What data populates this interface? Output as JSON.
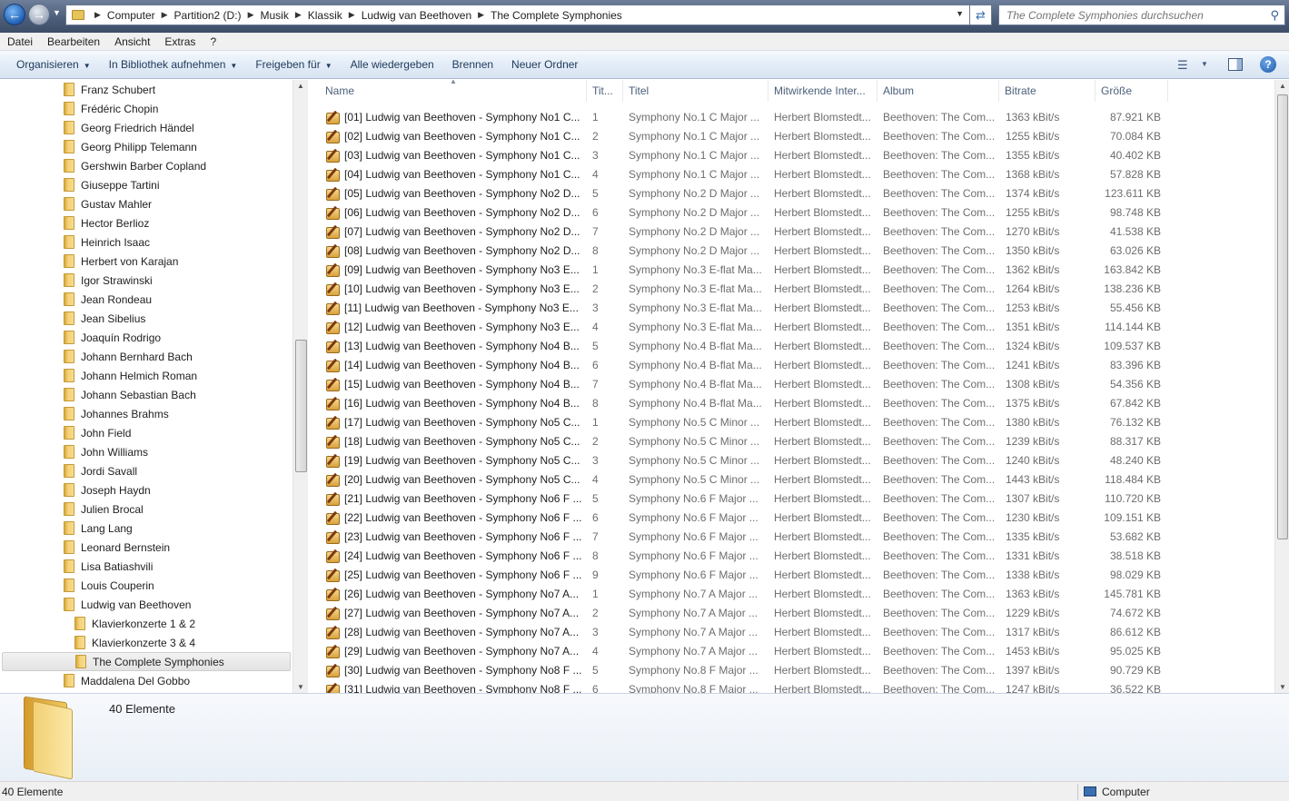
{
  "address": {
    "crumbs": [
      "Computer",
      "Partition2 (D:)",
      "Musik",
      "Klassik",
      "Ludwig van Beethoven",
      "The Complete Symphonies"
    ],
    "search_placeholder": "The Complete Symphonies durchsuchen"
  },
  "menu": [
    "Datei",
    "Bearbeiten",
    "Ansicht",
    "Extras",
    "?"
  ],
  "commands": [
    {
      "label": "Organisieren",
      "dropdown": true
    },
    {
      "label": "In Bibliothek aufnehmen",
      "dropdown": true
    },
    {
      "label": "Freigeben für",
      "dropdown": true
    },
    {
      "label": "Alle wiedergeben",
      "dropdown": false
    },
    {
      "label": "Brennen",
      "dropdown": false
    },
    {
      "label": "Neuer Ordner",
      "dropdown": false
    }
  ],
  "tree": [
    {
      "label": "Franz Schubert",
      "level": 1
    },
    {
      "label": "Frédéric Chopin",
      "level": 1
    },
    {
      "label": "Georg Friedrich Händel",
      "level": 1
    },
    {
      "label": "Georg Philipp Telemann",
      "level": 1
    },
    {
      "label": "Gershwin Barber Copland",
      "level": 1
    },
    {
      "label": "Giuseppe Tartini",
      "level": 1
    },
    {
      "label": "Gustav Mahler",
      "level": 1
    },
    {
      "label": "Hector Berlioz",
      "level": 1
    },
    {
      "label": "Heinrich Isaac",
      "level": 1
    },
    {
      "label": "Herbert von Karajan",
      "level": 1
    },
    {
      "label": "Igor Strawinski",
      "level": 1
    },
    {
      "label": "Jean Rondeau",
      "level": 1
    },
    {
      "label": "Jean Sibelius",
      "level": 1
    },
    {
      "label": "Joaquín Rodrigo",
      "level": 1
    },
    {
      "label": "Johann Bernhard Bach",
      "level": 1
    },
    {
      "label": "Johann Helmich Roman",
      "level": 1
    },
    {
      "label": "Johann Sebastian Bach",
      "level": 1
    },
    {
      "label": "Johannes Brahms",
      "level": 1
    },
    {
      "label": "John Field",
      "level": 1
    },
    {
      "label": "John Williams",
      "level": 1
    },
    {
      "label": "Jordi Savall",
      "level": 1
    },
    {
      "label": "Joseph Haydn",
      "level": 1
    },
    {
      "label": "Julien Brocal",
      "level": 1
    },
    {
      "label": "Lang Lang",
      "level": 1
    },
    {
      "label": "Leonard Bernstein",
      "level": 1
    },
    {
      "label": "Lisa Batiashvili",
      "level": 1
    },
    {
      "label": "Louis Couperin",
      "level": 1
    },
    {
      "label": "Ludwig van Beethoven",
      "level": 1
    },
    {
      "label": "Klavierkonzerte 1 & 2",
      "level": 2
    },
    {
      "label": "Klavierkonzerte 3 & 4",
      "level": 2
    },
    {
      "label": "The Complete Symphonies",
      "level": 2,
      "selected": true
    },
    {
      "label": "Maddalena Del Gobbo",
      "level": 1
    }
  ],
  "columns": [
    "Name",
    "Tit...",
    "Titel",
    "Mitwirkende Inter...",
    "Album",
    "Bitrate",
    "Größe"
  ],
  "files": [
    {
      "name": "[01] Ludwig van Beethoven - Symphony No1 C...",
      "track": "1",
      "title": "Symphony No.1 C Major ...",
      "artist": "Herbert Blomstedt...",
      "album": "Beethoven: The Com...",
      "bitrate": "1363 kBit/s",
      "size": "87.921 KB"
    },
    {
      "name": "[02] Ludwig van Beethoven - Symphony No1 C...",
      "track": "2",
      "title": "Symphony No.1 C Major ...",
      "artist": "Herbert Blomstedt...",
      "album": "Beethoven: The Com...",
      "bitrate": "1255 kBit/s",
      "size": "70.084 KB"
    },
    {
      "name": "[03] Ludwig van Beethoven - Symphony No1 C...",
      "track": "3",
      "title": "Symphony No.1 C Major ...",
      "artist": "Herbert Blomstedt...",
      "album": "Beethoven: The Com...",
      "bitrate": "1355 kBit/s",
      "size": "40.402 KB"
    },
    {
      "name": "[04] Ludwig van Beethoven - Symphony No1 C...",
      "track": "4",
      "title": "Symphony No.1 C Major ...",
      "artist": "Herbert Blomstedt...",
      "album": "Beethoven: The Com...",
      "bitrate": "1368 kBit/s",
      "size": "57.828 KB"
    },
    {
      "name": "[05] Ludwig van Beethoven - Symphony No2 D...",
      "track": "5",
      "title": "Symphony No.2 D Major ...",
      "artist": "Herbert Blomstedt...",
      "album": "Beethoven: The Com...",
      "bitrate": "1374 kBit/s",
      "size": "123.611 KB"
    },
    {
      "name": "[06] Ludwig van Beethoven - Symphony No2 D...",
      "track": "6",
      "title": "Symphony No.2 D Major ...",
      "artist": "Herbert Blomstedt...",
      "album": "Beethoven: The Com...",
      "bitrate": "1255 kBit/s",
      "size": "98.748 KB"
    },
    {
      "name": "[07] Ludwig van Beethoven - Symphony No2 D...",
      "track": "7",
      "title": "Symphony No.2 D Major ...",
      "artist": "Herbert Blomstedt...",
      "album": "Beethoven: The Com...",
      "bitrate": "1270 kBit/s",
      "size": "41.538 KB"
    },
    {
      "name": "[08] Ludwig van Beethoven - Symphony No2 D...",
      "track": "8",
      "title": "Symphony No.2 D Major ...",
      "artist": "Herbert Blomstedt...",
      "album": "Beethoven: The Com...",
      "bitrate": "1350 kBit/s",
      "size": "63.026 KB"
    },
    {
      "name": "[09] Ludwig van Beethoven - Symphony No3 E...",
      "track": "1",
      "title": "Symphony No.3 E-flat Ma...",
      "artist": "Herbert Blomstedt...",
      "album": "Beethoven: The Com...",
      "bitrate": "1362 kBit/s",
      "size": "163.842 KB"
    },
    {
      "name": "[10] Ludwig van Beethoven - Symphony No3 E...",
      "track": "2",
      "title": "Symphony No.3 E-flat Ma...",
      "artist": "Herbert Blomstedt...",
      "album": "Beethoven: The Com...",
      "bitrate": "1264 kBit/s",
      "size": "138.236 KB"
    },
    {
      "name": "[11] Ludwig van Beethoven - Symphony No3 E...",
      "track": "3",
      "title": "Symphony No.3 E-flat Ma...",
      "artist": "Herbert Blomstedt...",
      "album": "Beethoven: The Com...",
      "bitrate": "1253 kBit/s",
      "size": "55.456 KB"
    },
    {
      "name": "[12] Ludwig van Beethoven - Symphony No3 E...",
      "track": "4",
      "title": "Symphony No.3 E-flat Ma...",
      "artist": "Herbert Blomstedt...",
      "album": "Beethoven: The Com...",
      "bitrate": "1351 kBit/s",
      "size": "114.144 KB"
    },
    {
      "name": "[13] Ludwig van Beethoven - Symphony No4 B...",
      "track": "5",
      "title": "Symphony No.4 B-flat Ma...",
      "artist": "Herbert Blomstedt...",
      "album": "Beethoven: The Com...",
      "bitrate": "1324 kBit/s",
      "size": "109.537 KB"
    },
    {
      "name": "[14] Ludwig van Beethoven - Symphony No4 B...",
      "track": "6",
      "title": "Symphony No.4 B-flat Ma...",
      "artist": "Herbert Blomstedt...",
      "album": "Beethoven: The Com...",
      "bitrate": "1241 kBit/s",
      "size": "83.396 KB"
    },
    {
      "name": "[15] Ludwig van Beethoven - Symphony No4 B...",
      "track": "7",
      "title": "Symphony No.4 B-flat Ma...",
      "artist": "Herbert Blomstedt...",
      "album": "Beethoven: The Com...",
      "bitrate": "1308 kBit/s",
      "size": "54.356 KB"
    },
    {
      "name": "[16] Ludwig van Beethoven - Symphony No4 B...",
      "track": "8",
      "title": "Symphony No.4 B-flat Ma...",
      "artist": "Herbert Blomstedt...",
      "album": "Beethoven: The Com...",
      "bitrate": "1375 kBit/s",
      "size": "67.842 KB"
    },
    {
      "name": "[17] Ludwig van Beethoven - Symphony No5 C...",
      "track": "1",
      "title": "Symphony No.5 C Minor ...",
      "artist": "Herbert Blomstedt...",
      "album": "Beethoven: The Com...",
      "bitrate": "1380 kBit/s",
      "size": "76.132 KB"
    },
    {
      "name": "[18] Ludwig van Beethoven - Symphony No5 C...",
      "track": "2",
      "title": "Symphony No.5 C Minor ...",
      "artist": "Herbert Blomstedt...",
      "album": "Beethoven: The Com...",
      "bitrate": "1239 kBit/s",
      "size": "88.317 KB"
    },
    {
      "name": "[19] Ludwig van Beethoven - Symphony No5 C...",
      "track": "3",
      "title": "Symphony No.5 C Minor ...",
      "artist": "Herbert Blomstedt...",
      "album": "Beethoven: The Com...",
      "bitrate": "1240 kBit/s",
      "size": "48.240 KB"
    },
    {
      "name": "[20] Ludwig van Beethoven - Symphony No5 C...",
      "track": "4",
      "title": "Symphony No.5 C Minor ...",
      "artist": "Herbert Blomstedt...",
      "album": "Beethoven: The Com...",
      "bitrate": "1443 kBit/s",
      "size": "118.484 KB"
    },
    {
      "name": "[21] Ludwig van Beethoven - Symphony No6 F ...",
      "track": "5",
      "title": "Symphony No.6 F Major ...",
      "artist": "Herbert Blomstedt...",
      "album": "Beethoven: The Com...",
      "bitrate": "1307 kBit/s",
      "size": "110.720 KB"
    },
    {
      "name": "[22] Ludwig van Beethoven - Symphony No6 F ...",
      "track": "6",
      "title": "Symphony No.6 F Major ...",
      "artist": "Herbert Blomstedt...",
      "album": "Beethoven: The Com...",
      "bitrate": "1230 kBit/s",
      "size": "109.151 KB"
    },
    {
      "name": "[23] Ludwig van Beethoven - Symphony No6 F ...",
      "track": "7",
      "title": "Symphony No.6 F Major ...",
      "artist": "Herbert Blomstedt...",
      "album": "Beethoven: The Com...",
      "bitrate": "1335 kBit/s",
      "size": "53.682 KB"
    },
    {
      "name": "[24] Ludwig van Beethoven - Symphony No6 F ...",
      "track": "8",
      "title": "Symphony No.6 F Major ...",
      "artist": "Herbert Blomstedt...",
      "album": "Beethoven: The Com...",
      "bitrate": "1331 kBit/s",
      "size": "38.518 KB"
    },
    {
      "name": "[25] Ludwig van Beethoven - Symphony No6 F ...",
      "track": "9",
      "title": "Symphony No.6 F Major ...",
      "artist": "Herbert Blomstedt...",
      "album": "Beethoven: The Com...",
      "bitrate": "1338 kBit/s",
      "size": "98.029 KB"
    },
    {
      "name": "[26] Ludwig van Beethoven - Symphony No7 A...",
      "track": "1",
      "title": "Symphony No.7 A Major ...",
      "artist": "Herbert Blomstedt...",
      "album": "Beethoven: The Com...",
      "bitrate": "1363 kBit/s",
      "size": "145.781 KB"
    },
    {
      "name": "[27] Ludwig van Beethoven - Symphony No7 A...",
      "track": "2",
      "title": "Symphony No.7 A Major ...",
      "artist": "Herbert Blomstedt...",
      "album": "Beethoven: The Com...",
      "bitrate": "1229 kBit/s",
      "size": "74.672 KB"
    },
    {
      "name": "[28] Ludwig van Beethoven - Symphony No7 A...",
      "track": "3",
      "title": "Symphony No.7 A Major ...",
      "artist": "Herbert Blomstedt...",
      "album": "Beethoven: The Com...",
      "bitrate": "1317 kBit/s",
      "size": "86.612 KB"
    },
    {
      "name": "[29] Ludwig van Beethoven - Symphony No7 A...",
      "track": "4",
      "title": "Symphony No.7 A Major ...",
      "artist": "Herbert Blomstedt...",
      "album": "Beethoven: The Com...",
      "bitrate": "1453 kBit/s",
      "size": "95.025 KB"
    },
    {
      "name": "[30] Ludwig van Beethoven - Symphony No8 F ...",
      "track": "5",
      "title": "Symphony No.8 F Major ...",
      "artist": "Herbert Blomstedt...",
      "album": "Beethoven: The Com...",
      "bitrate": "1397 kBit/s",
      "size": "90.729 KB"
    },
    {
      "name": "[31] Ludwig van Beethoven - Symphony No8 F ...",
      "track": "6",
      "title": "Symphony No.8 F Major ...",
      "artist": "Herbert Blomstedt...",
      "album": "Beethoven: The Com...",
      "bitrate": "1247 kBit/s",
      "size": "36.522 KB"
    }
  ],
  "details": {
    "count": "40 Elemente"
  },
  "status": {
    "count": "40 Elemente",
    "location": "Computer"
  },
  "icons": {
    "back": "back-arrow-icon",
    "forward": "forward-arrow-icon",
    "search": "search-icon",
    "folder": "folder-icon",
    "music": "music-file-icon",
    "help": "help-icon"
  }
}
